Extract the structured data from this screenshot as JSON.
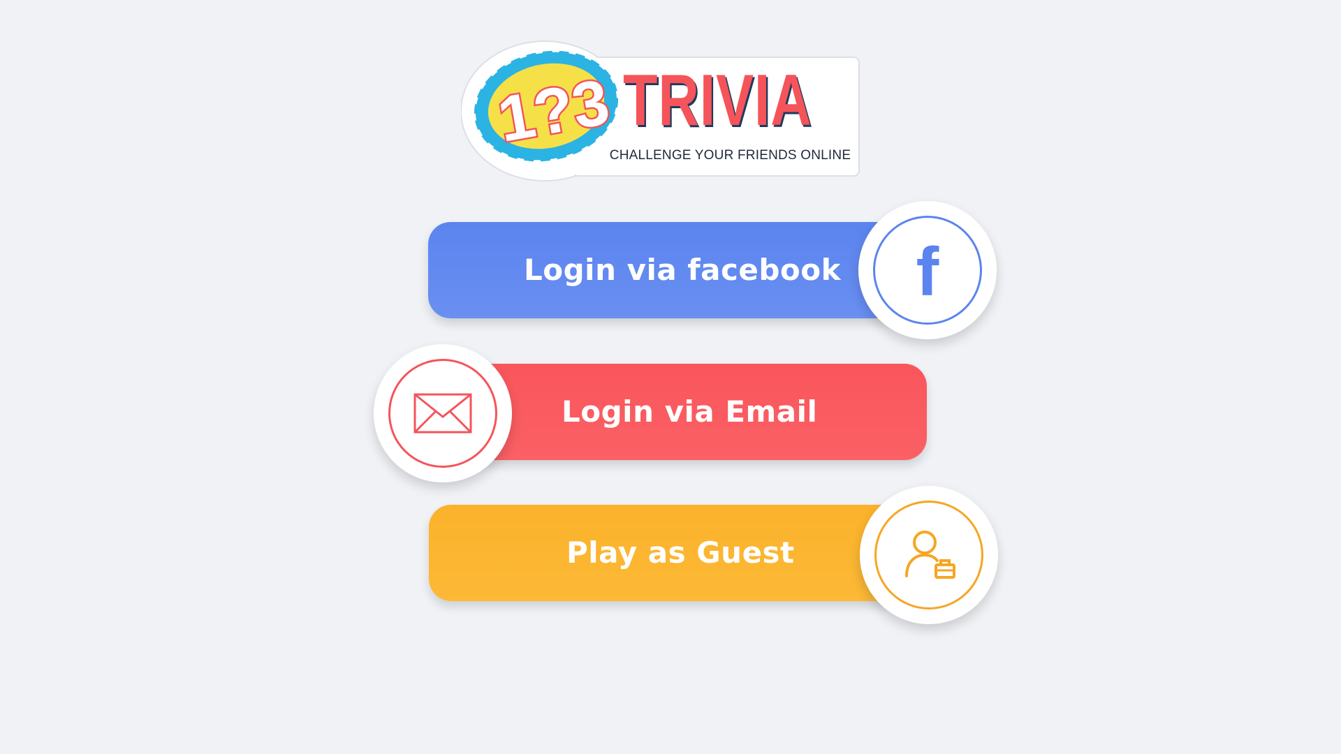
{
  "logo": {
    "numerals": "1?3",
    "wordmark": "TRIVIA",
    "tagline": "CHALLENGE YOUR FRIENDS ONLINE"
  },
  "buttons": {
    "facebook": {
      "label": "Login via facebook",
      "icon": "facebook-icon",
      "glyph": "f",
      "color": "#5b84ee"
    },
    "email": {
      "label": "Login via Email",
      "icon": "mail-icon",
      "color": "#f9565c"
    },
    "guest": {
      "label": "Play as Guest",
      "icon": "guest-user-icon",
      "color": "#fbb22b"
    }
  },
  "theme": {
    "background": "#f0f2f6",
    "logo_red": "#f4545a",
    "logo_yellow": "#f6e048",
    "logo_cyan": "#2bb3e3"
  }
}
